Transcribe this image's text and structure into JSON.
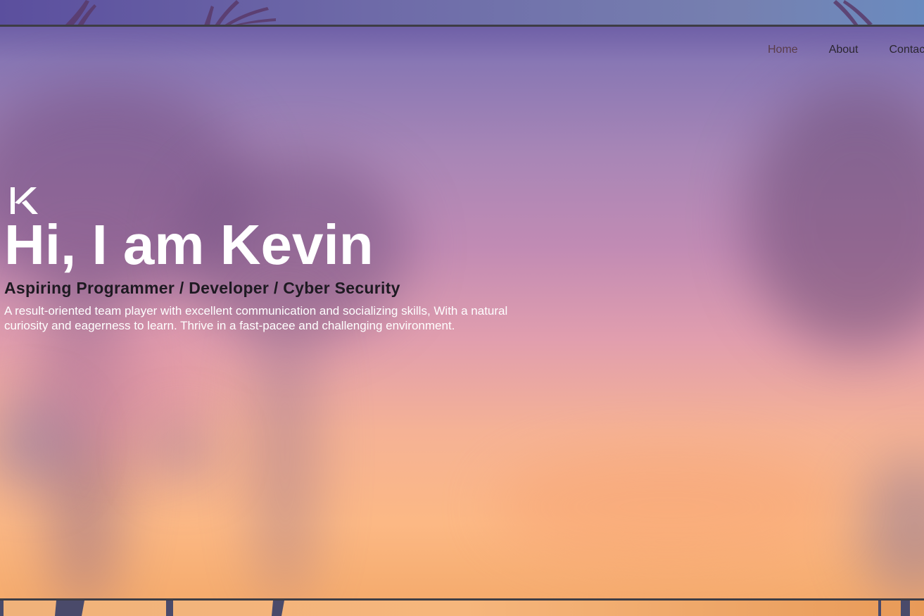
{
  "nav": {
    "items": [
      {
        "label": "Home",
        "active": true
      },
      {
        "label": "About",
        "active": false
      },
      {
        "label": "Contact",
        "active": false
      }
    ]
  },
  "hero": {
    "logo_icon": "k-monogram-logo",
    "title": "Hi, I am Kevin",
    "subtitle": "Aspiring Programmer / Developer / Cyber Security",
    "description": "A result-oriented team player with excellent communication and socializing skills, With a natural curiosity and eagerness to learn. Thrive in a fast-pacee and challenging environment."
  },
  "colors": {
    "title": "#ffffff",
    "subtitle": "#1e1a22",
    "nav_text": "#2b2630",
    "nav_active": "#5a3d4a",
    "frame_border": "#3d3d45"
  }
}
